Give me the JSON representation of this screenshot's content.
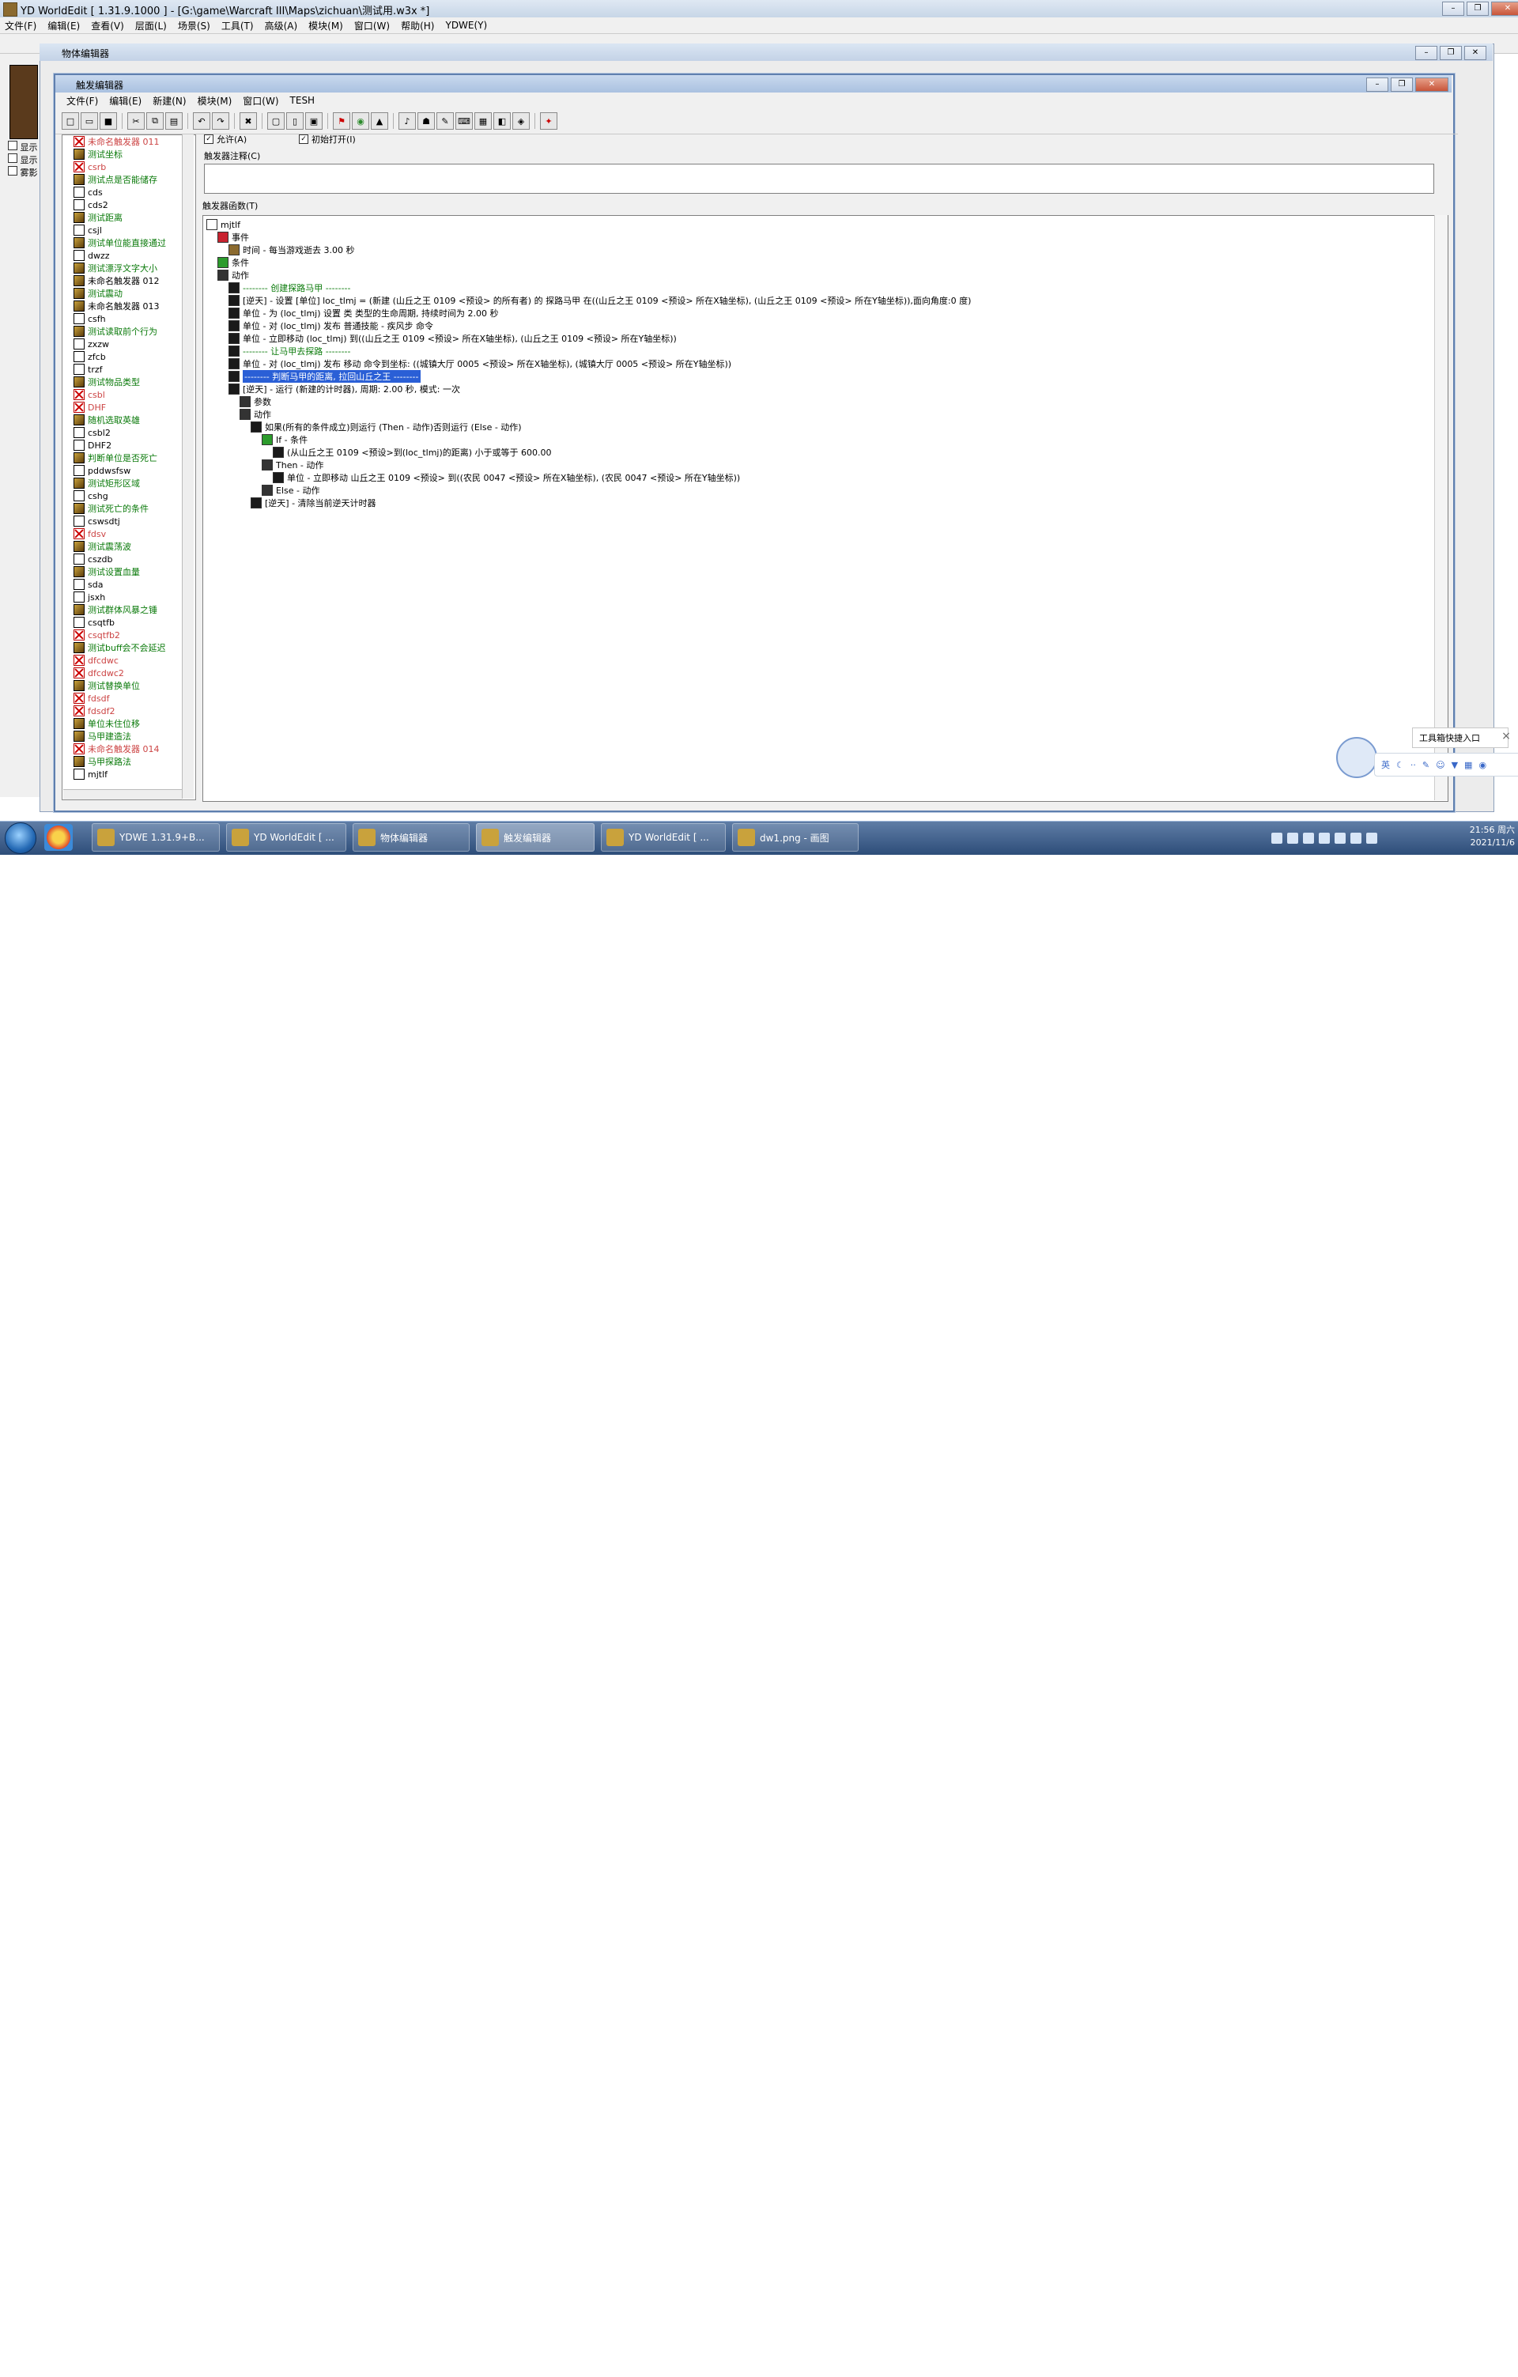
{
  "app": {
    "title": "YD WorldEdit [ 1.31.9.1000 ] - [G:\\game\\Warcraft III\\Maps\\zichuan\\测试用.w3x *]",
    "menu": [
      "文件(F)",
      "编辑(E)",
      "查看(V)",
      "层面(L)",
      "场景(S)",
      "工具(T)",
      "高级(A)",
      "模块(M)",
      "窗口(W)",
      "帮助(H)",
      "YDWE(Y)"
    ],
    "left_checks": [
      "显示",
      "显示",
      "雾影"
    ]
  },
  "object_editor": {
    "title": "物体编辑器"
  },
  "trigger_editor": {
    "title": "触发编辑器",
    "menu": [
      "文件(F)",
      "编辑(E)",
      "新建(N)",
      "模块(M)",
      "窗口(W)",
      "TESH"
    ],
    "allow_label": "允许(A)",
    "initially_on_label": "初始打开(I)",
    "comment_label": "触发器注释(C)",
    "functions_label": "触发器函数(T)",
    "list": [
      {
        "label": "未命名触发器 011",
        "style": "red",
        "icon": "dis"
      },
      {
        "label": "测试坐标",
        "style": "green",
        "icon": "tr"
      },
      {
        "label": "csrb",
        "style": "red",
        "icon": "dis"
      },
      {
        "label": "测试点是否能储存",
        "style": "green",
        "icon": "tr"
      },
      {
        "label": "cds",
        "style": "",
        "icon": "doc"
      },
      {
        "label": "cds2",
        "style": "",
        "icon": "doc"
      },
      {
        "label": "测试距离",
        "style": "green",
        "icon": "tr"
      },
      {
        "label": "csjl",
        "style": "",
        "icon": "doc"
      },
      {
        "label": "测试单位能直接通过",
        "style": "green",
        "icon": "tr"
      },
      {
        "label": "dwzz",
        "style": "",
        "icon": "doc"
      },
      {
        "label": "测试漂浮文字大小",
        "style": "green",
        "icon": "tr"
      },
      {
        "label": "未命名触发器 012",
        "style": "",
        "icon": "tr"
      },
      {
        "label": "测试震动",
        "style": "green",
        "icon": "tr"
      },
      {
        "label": "未命名触发器 013",
        "style": "",
        "icon": "tr"
      },
      {
        "label": "csfh",
        "style": "",
        "icon": "doc"
      },
      {
        "label": "测试读取前个行为",
        "style": "green",
        "icon": "tr"
      },
      {
        "label": "zxzw",
        "style": "",
        "icon": "doc"
      },
      {
        "label": "zfcb",
        "style": "",
        "icon": "doc"
      },
      {
        "label": "trzf",
        "style": "",
        "icon": "doc"
      },
      {
        "label": "测试物品类型",
        "style": "green",
        "icon": "tr"
      },
      {
        "label": "csbl",
        "style": "red",
        "icon": "dis"
      },
      {
        "label": "DHF",
        "style": "red",
        "icon": "dis"
      },
      {
        "label": "随机选取英雄",
        "style": "green",
        "icon": "tr"
      },
      {
        "label": "csbl2",
        "style": "",
        "icon": "doc"
      },
      {
        "label": "DHF2",
        "style": "",
        "icon": "doc"
      },
      {
        "label": "判断单位是否死亡",
        "style": "green",
        "icon": "tr"
      },
      {
        "label": "pddwsfsw",
        "style": "",
        "icon": "doc"
      },
      {
        "label": "测试矩形区域",
        "style": "green",
        "icon": "tr"
      },
      {
        "label": "cshg",
        "style": "",
        "icon": "doc"
      },
      {
        "label": "测试死亡的条件",
        "style": "green",
        "icon": "tr"
      },
      {
        "label": "cswsdtj",
        "style": "",
        "icon": "doc"
      },
      {
        "label": "fdsv",
        "style": "red",
        "icon": "dis"
      },
      {
        "label": "测试震荡波",
        "style": "green",
        "icon": "tr"
      },
      {
        "label": "cszdb",
        "style": "",
        "icon": "doc"
      },
      {
        "label": "测试设置血量",
        "style": "green",
        "icon": "tr"
      },
      {
        "label": "sda",
        "style": "",
        "icon": "doc"
      },
      {
        "label": "jsxh",
        "style": "",
        "icon": "doc"
      },
      {
        "label": "测试群体风暴之锤",
        "style": "green",
        "icon": "tr"
      },
      {
        "label": "csqtfb",
        "style": "",
        "icon": "doc"
      },
      {
        "label": "csqtfb2",
        "style": "red",
        "icon": "dis"
      },
      {
        "label": "测试buff会不会延迟",
        "style": "green",
        "icon": "tr"
      },
      {
        "label": "dfcdwc",
        "style": "red",
        "icon": "dis"
      },
      {
        "label": "dfcdwc2",
        "style": "red",
        "icon": "dis"
      },
      {
        "label": "测试替换单位",
        "style": "green",
        "icon": "tr"
      },
      {
        "label": "fdsdf",
        "style": "red",
        "icon": "dis"
      },
      {
        "label": "fdsdf2",
        "style": "red",
        "icon": "dis"
      },
      {
        "label": "单位未住位移",
        "style": "green",
        "icon": "tr"
      },
      {
        "label": "马甲建造法",
        "style": "green",
        "icon": "tr"
      },
      {
        "label": "未命名触发器 014",
        "style": "red",
        "icon": "dis"
      },
      {
        "label": "马甲探路法",
        "style": "green",
        "icon": "tr"
      },
      {
        "label": "mjtlf",
        "style": "",
        "icon": "doc"
      }
    ],
    "tree": [
      {
        "label": "mjtlf",
        "icon": "doc",
        "indent": 0,
        "style": ""
      },
      {
        "label": "事件",
        "icon": "flag",
        "indent": 1,
        "style": ""
      },
      {
        "label": "时间 - 每当游戏逝去 3.00 秒",
        "icon": "evt",
        "indent": 2,
        "style": ""
      },
      {
        "label": "条件",
        "icon": "cond",
        "indent": 1,
        "style": ""
      },
      {
        "label": "动作",
        "icon": "folder",
        "indent": 1,
        "style": ""
      },
      {
        "label": "-------- 创建探路马甲 --------",
        "icon": "act",
        "indent": 2,
        "style": "green"
      },
      {
        "label": "[逆天] - 设置 [单位] loc_tlmj = (新建 (山丘之王 0109 <预设> 的所有者) 的 探路马甲 在((山丘之王 0109 <预设> 所在X轴坐标), (山丘之王 0109 <预设> 所在Y轴坐标)),面向角度:0 度)",
        "icon": "act",
        "indent": 2,
        "style": ""
      },
      {
        "label": "单位 - 为 (loc_tlmj) 设置 类 类型的生命周期, 持续时间为 2.00 秒",
        "icon": "act",
        "indent": 2,
        "style": ""
      },
      {
        "label": "单位 - 对 (loc_tlmj) 发布 普通技能 - 疾风步 命令",
        "icon": "act",
        "indent": 2,
        "style": ""
      },
      {
        "label": "单位 - 立即移动 (loc_tlmj) 到((山丘之王 0109 <预设> 所在X轴坐标), (山丘之王 0109 <预设> 所在Y轴坐标))",
        "icon": "act",
        "indent": 2,
        "style": ""
      },
      {
        "label": "-------- 让马甲去探路 --------",
        "icon": "act",
        "indent": 2,
        "style": "green"
      },
      {
        "label": "单位 - 对 (loc_tlmj) 发布 移动 命令到坐标: ((城镇大厅 0005 <预设> 所在X轴坐标), (城镇大厅 0005 <预设> 所在Y轴坐标))",
        "icon": "act",
        "indent": 2,
        "style": ""
      },
      {
        "label": "-------- 判断马甲的距离, 拉回山丘之王 --------",
        "icon": "act",
        "indent": 2,
        "style": "selected"
      },
      {
        "label": "[逆天] - 运行 (新建的计时器), 周期: 2.00 秒, 模式: 一次",
        "icon": "act",
        "indent": 2,
        "style": ""
      },
      {
        "label": "参数",
        "icon": "folder",
        "indent": 3,
        "style": ""
      },
      {
        "label": "动作",
        "icon": "folder",
        "indent": 3,
        "style": ""
      },
      {
        "label": "如果(所有的条件成立)则运行 (Then - 动作)否则运行 (Else - 动作)",
        "icon": "act",
        "indent": 4,
        "style": ""
      },
      {
        "label": "If - 条件",
        "icon": "cond",
        "indent": 5,
        "style": ""
      },
      {
        "label": "(从山丘之王 0109 <预设>到(loc_tlmj)的距离) 小于或等于 600.00",
        "icon": "act",
        "indent": 6,
        "style": ""
      },
      {
        "label": "Then - 动作",
        "icon": "folder",
        "indent": 5,
        "style": ""
      },
      {
        "label": "单位 - 立即移动 山丘之王 0109 <预设> 到((农民 0047 <预设> 所在X轴坐标), (农民 0047 <预设> 所在Y轴坐标))",
        "icon": "act",
        "indent": 6,
        "style": ""
      },
      {
        "label": "Else - 动作",
        "icon": "folder",
        "indent": 5,
        "style": ""
      },
      {
        "label": "[逆天] - 清除当前逆天计时器",
        "icon": "act",
        "indent": 4,
        "style": ""
      }
    ]
  },
  "widget": {
    "tool_entry": "工具箱快捷入口",
    "ime_label": "英"
  },
  "taskbar": {
    "tasks": [
      "YDWE 1.31.9+B...",
      "YD WorldEdit [ ...",
      "物体编辑器",
      "触发编辑器",
      "YD WorldEdit [ ...",
      "dw1.png - 画图"
    ],
    "time": "21:56 周六",
    "date": "2021/11/6"
  }
}
